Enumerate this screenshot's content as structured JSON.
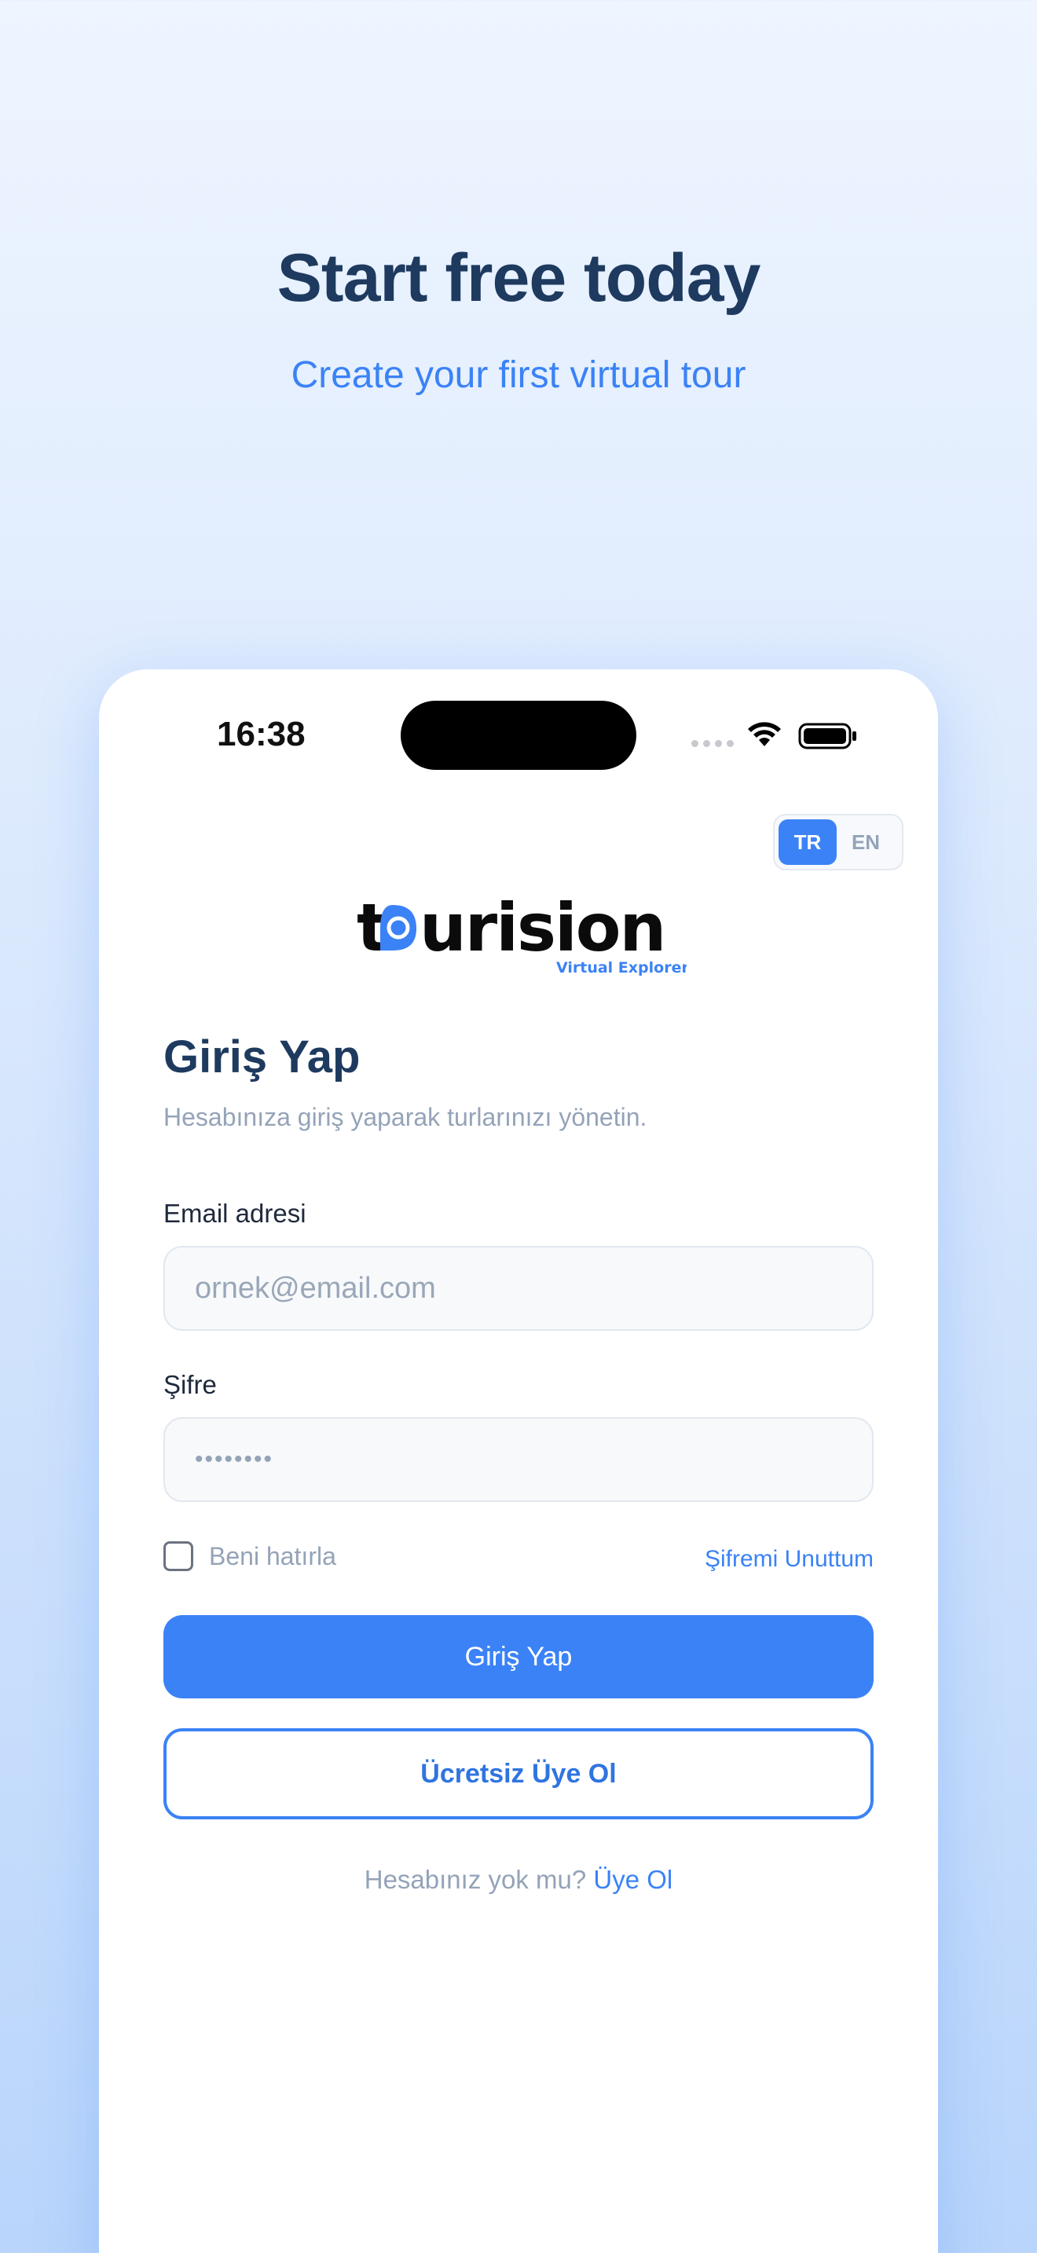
{
  "hero": {
    "title": "Start free today",
    "subtitle": "Create your first virtual tour"
  },
  "status_bar": {
    "time": "16:38",
    "icons": [
      "signal-icon",
      "wifi-icon",
      "battery-icon"
    ]
  },
  "language": {
    "options": [
      "TR",
      "EN"
    ],
    "selected": "TR"
  },
  "logo": {
    "brand": "tourision",
    "tagline": "Virtual Explorer"
  },
  "login": {
    "title": "Giriş Yap",
    "subtitle": "Hesabınıza giriş yaparak turlarınızı yönetin.",
    "email_label": "Email adresi",
    "email_placeholder": "ornek@email.com",
    "password_label": "Şifre",
    "password_value": "••••••••",
    "remember_label": "Beni hatırla",
    "forgot_label": "Şifremi Unuttum",
    "submit_label": "Giriş Yap",
    "signup_button_label": "Ücretsiz Üye Ol",
    "footer_text": "Hesabınız yok mu?",
    "footer_link": "Üye Ol"
  },
  "colors": {
    "accent": "#3b82f6",
    "heading": "#1e3a5f",
    "muted": "#94a3b8"
  }
}
